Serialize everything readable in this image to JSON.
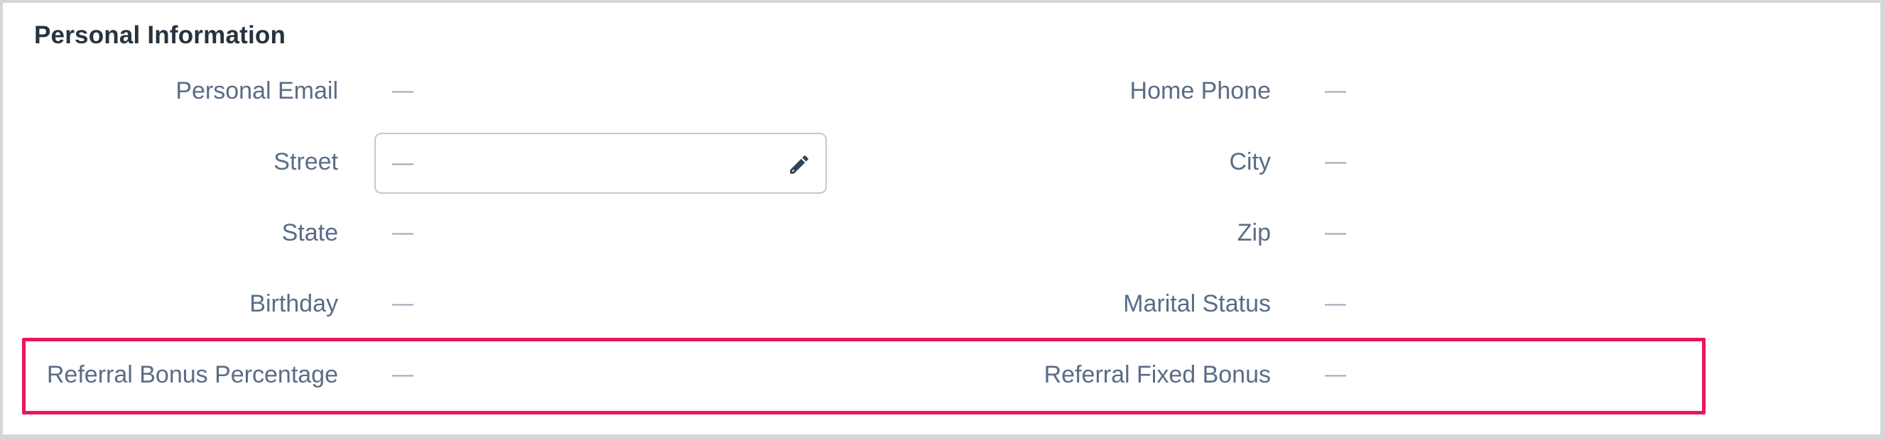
{
  "section": {
    "title": "Personal Information"
  },
  "fields": {
    "personal_email": {
      "label": "Personal Email",
      "value": "—"
    },
    "home_phone": {
      "label": "Home Phone",
      "value": "—"
    },
    "street": {
      "label": "Street",
      "value": "—"
    },
    "city": {
      "label": "City",
      "value": "—"
    },
    "state": {
      "label": "State",
      "value": "—"
    },
    "zip": {
      "label": "Zip",
      "value": "—"
    },
    "birthday": {
      "label": "Birthday",
      "value": "—"
    },
    "marital_status": {
      "label": "Marital Status",
      "value": "—"
    },
    "referral_bonus_percentage": {
      "label": "Referral Bonus Percentage",
      "value": "—"
    },
    "referral_fixed_bonus": {
      "label": "Referral Fixed Bonus",
      "value": "—"
    }
  },
  "icons": {
    "edit": "pencil-icon"
  },
  "colors": {
    "highlight": "#e8175d",
    "label": "#5a6c86",
    "title": "#26333f"
  }
}
